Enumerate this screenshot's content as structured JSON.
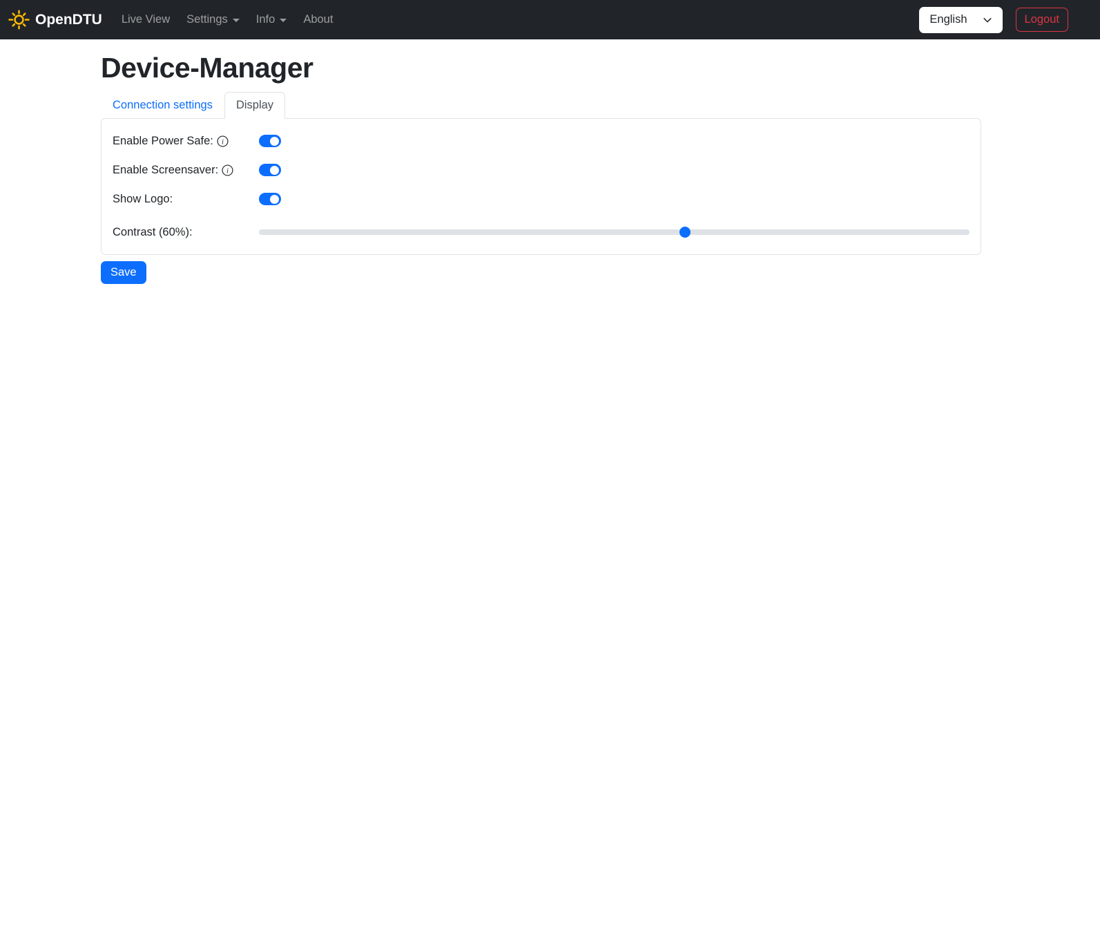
{
  "navbar": {
    "brand": "OpenDTU",
    "items": [
      {
        "label": "Live View",
        "dropdown": false
      },
      {
        "label": "Settings",
        "dropdown": true
      },
      {
        "label": "Info",
        "dropdown": true
      },
      {
        "label": "About",
        "dropdown": false
      }
    ],
    "language": {
      "selected": "English"
    },
    "logout_label": "Logout"
  },
  "page": {
    "title": "Device-Manager",
    "tabs": [
      {
        "label": "Connection settings",
        "active": false
      },
      {
        "label": "Display",
        "active": true
      }
    ]
  },
  "form": {
    "rows": [
      {
        "label": "Enable Power Safe:",
        "type": "switch",
        "info": true,
        "value": true
      },
      {
        "label": "Enable Screensaver:",
        "type": "switch",
        "info": true,
        "value": true
      },
      {
        "label": "Show Logo:",
        "type": "switch",
        "info": false,
        "value": true
      },
      {
        "label": "Contrast (60%):",
        "type": "slider",
        "info": false,
        "value": 60,
        "min": 0,
        "max": 100
      }
    ],
    "save_label": "Save"
  },
  "colors": {
    "primary": "#0d6efd",
    "danger": "#dc3545",
    "navbar_bg": "#212529",
    "border": "#dee2e6",
    "sun": "#ffc107",
    "inactive_nav_link": "rgba(255,255,255,0.55)"
  }
}
